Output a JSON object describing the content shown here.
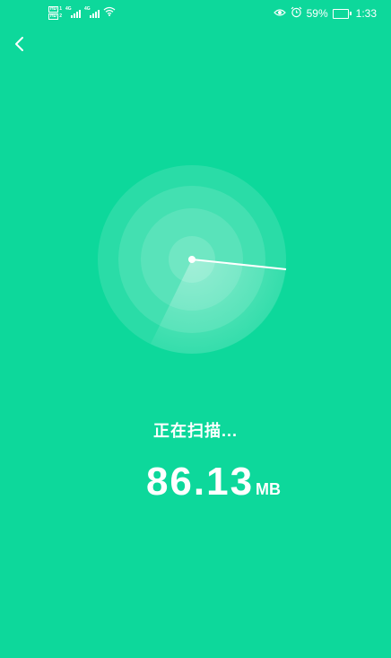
{
  "status_bar": {
    "hd_label_1": "HD",
    "hd_sub_1": "1",
    "hd_label_2": "HD",
    "hd_sub_2": "2",
    "network_1": "4G",
    "network_2": "4G",
    "icons": [
      "wifi-icon",
      "eye-icon",
      "alarm-icon",
      "battery-icon"
    ],
    "battery_percent": "59%",
    "battery_level": 0.59,
    "time": "1:33"
  },
  "header": {
    "back_icon": "chevron-left-icon"
  },
  "scan": {
    "status_text": "正在扫描...",
    "size_value": "86.13",
    "size_unit": "MB"
  },
  "colors": {
    "background": "#0dd89b",
    "foreground": "#ffffff"
  }
}
